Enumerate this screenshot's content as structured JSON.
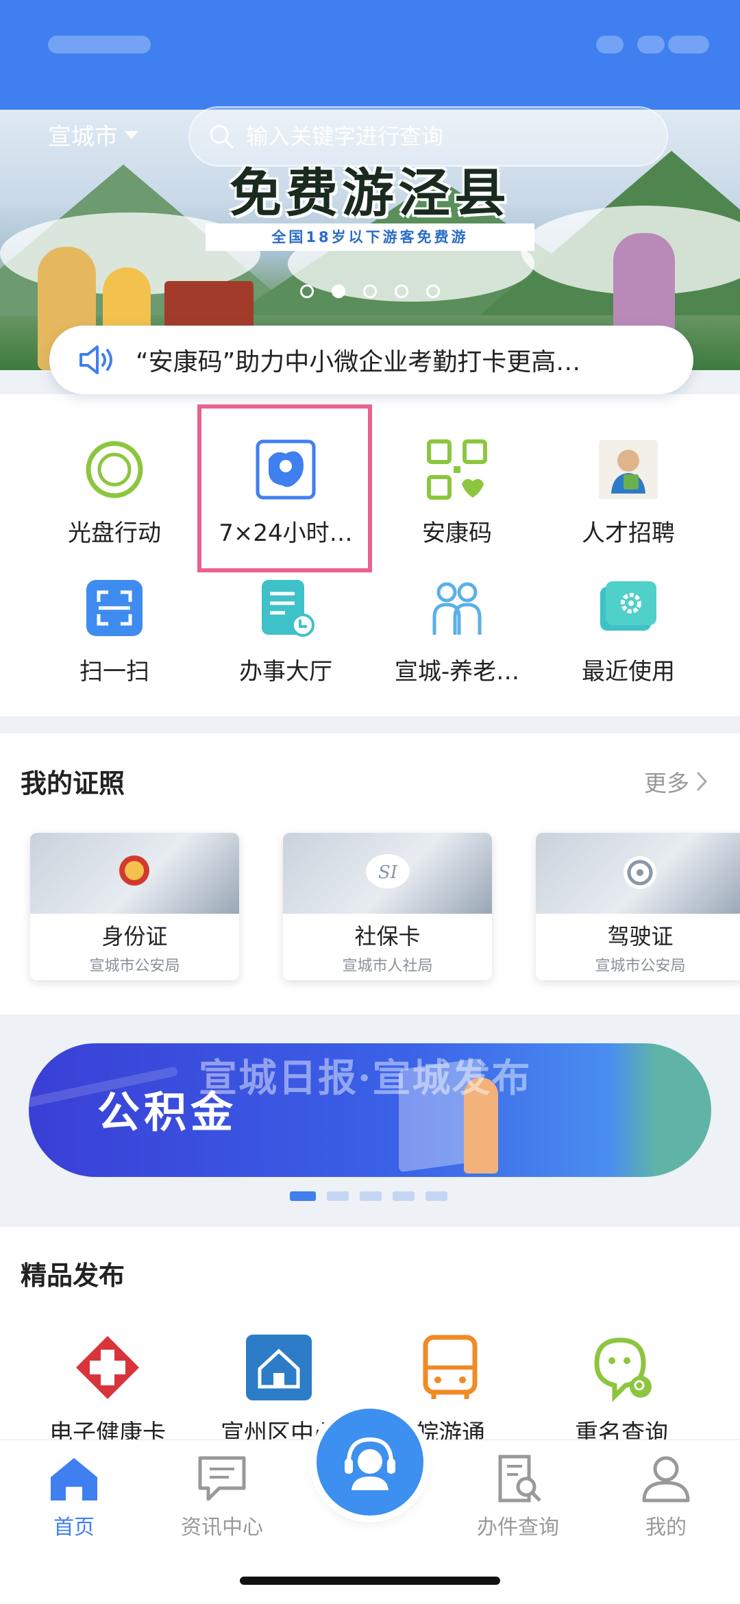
{
  "header": {
    "city": "宣城市",
    "search_placeholder": "输入关键字进行查询"
  },
  "banner": {
    "title": "免费游泾县",
    "subtitle": "全国18岁以下游客免费游",
    "slide_count": 5,
    "active_slide": 2
  },
  "notice": {
    "text": "“安康码”助力中小微企业考勤打卡更高…"
  },
  "services": [
    {
      "label": "光盘行动",
      "icon": "ring-icon"
    },
    {
      "label": "7×24小时…",
      "icon": "map-location-icon"
    },
    {
      "label": "安康码",
      "icon": "qr-health-icon"
    },
    {
      "label": "人才招聘",
      "icon": "recruit-icon"
    },
    {
      "label": "扫一扫",
      "icon": "scan-icon"
    },
    {
      "label": "办事大厅",
      "icon": "document-icon"
    },
    {
      "label": "宣城-养老…",
      "icon": "elderly-icon"
    },
    {
      "label": "最近使用",
      "icon": "gear-folder-icon"
    }
  ],
  "licenses": {
    "title": "我的证照",
    "more": "更多",
    "cards": [
      {
        "name": "身份证",
        "org": "宣城市公安局"
      },
      {
        "name": "社保卡",
        "org": "宣城市人社局"
      },
      {
        "name": "驾驶证",
        "org": "宣城市公安局"
      }
    ]
  },
  "fund_banner": {
    "title": "公积金",
    "watermark": "宣城日报·宣城发布",
    "page_count": 5,
    "active_page": 1
  },
  "publish": {
    "title": "精品发布",
    "items": [
      {
        "label": "电子健康卡",
        "icon": "medical-cross-icon"
      },
      {
        "label": "宣州区中心",
        "icon": "house-icon"
      },
      {
        "label": "皖游通",
        "icon": "bus-icon"
      },
      {
        "label": "重名查询",
        "icon": "name-search-icon"
      }
    ]
  },
  "tabbar": {
    "tabs": [
      {
        "label": "首页",
        "icon": "home-icon",
        "active": true
      },
      {
        "label": "资讯中心",
        "icon": "message-icon",
        "active": false
      },
      {
        "label": "",
        "icon": "customer-service-icon",
        "active": false
      },
      {
        "label": "办件查询",
        "icon": "document-search-icon",
        "active": false
      },
      {
        "label": "我的",
        "icon": "user-icon",
        "active": false
      }
    ]
  },
  "colors": {
    "primary": "#3f7ff0",
    "highlight": "#e8628d",
    "green": "#8cc63f"
  }
}
